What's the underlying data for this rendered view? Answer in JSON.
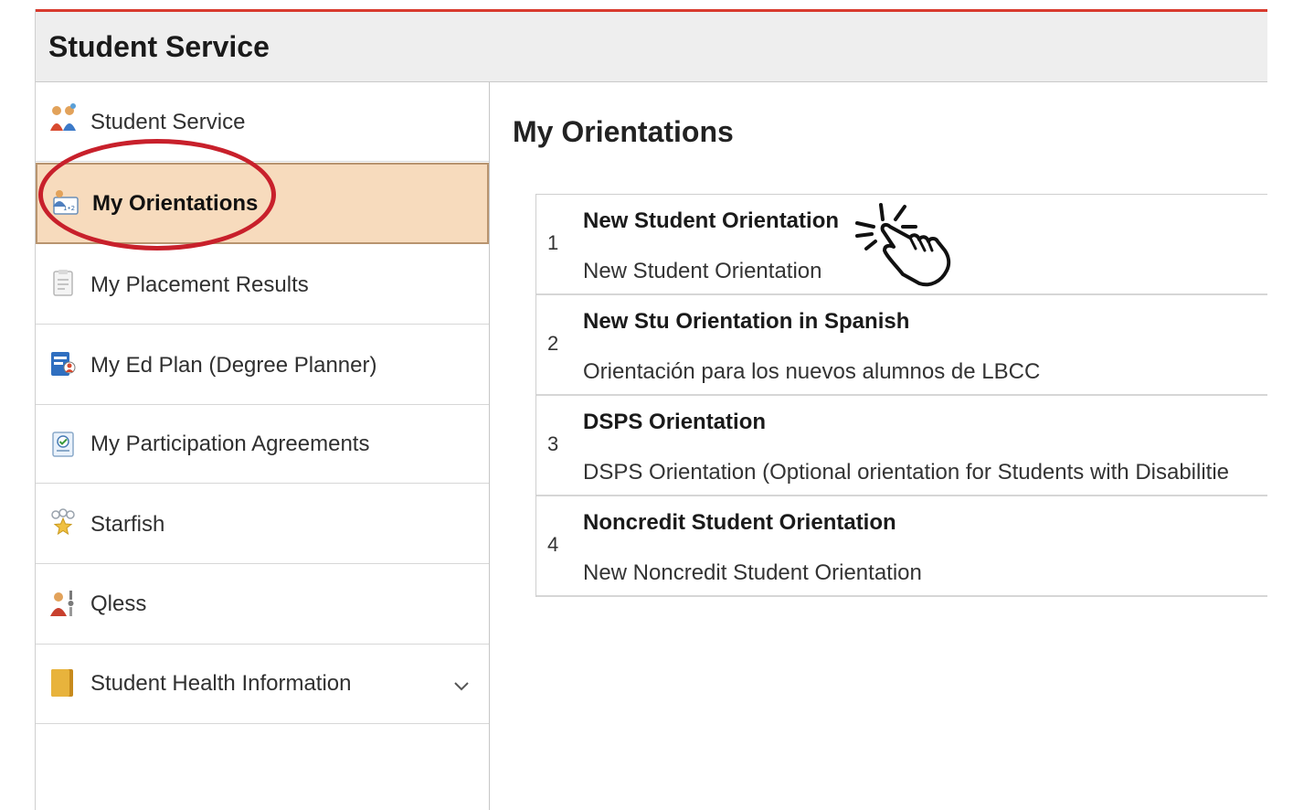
{
  "header": {
    "title": "Student Service"
  },
  "sidebar": {
    "items": [
      {
        "label": "Student Service",
        "icon": "people-icon"
      },
      {
        "label": "My Orientations",
        "icon": "orientation-icon",
        "selected": true
      },
      {
        "label": "My Placement Results",
        "icon": "document-icon"
      },
      {
        "label": "My Ed Plan (Degree Planner)",
        "icon": "planner-icon"
      },
      {
        "label": "My Participation Agreements",
        "icon": "agreement-icon"
      },
      {
        "label": "Starfish",
        "icon": "starfish-icon"
      },
      {
        "label": "Qless",
        "icon": "queue-icon"
      },
      {
        "label": "Student Health Information",
        "icon": "folder-icon",
        "expandable": true
      }
    ]
  },
  "main": {
    "title": "My Orientations",
    "orientations": [
      {
        "number": "1",
        "title": "New Student Orientation",
        "description": "New Student Orientation"
      },
      {
        "number": "2",
        "title": "New Stu Orientation in Spanish",
        "description": "Orientación para los nuevos alumnos de LBCC"
      },
      {
        "number": "3",
        "title": "DSPS Orientation",
        "description": "DSPS Orientation (Optional orientation for Students with Disabilitie"
      },
      {
        "number": "4",
        "title": "Noncredit Student Orientation",
        "description": "New Noncredit Student Orientation"
      }
    ]
  },
  "colors": {
    "accent": "#d83a2e",
    "selected_bg": "#f7dbbd",
    "highlight": "#c8202b"
  }
}
